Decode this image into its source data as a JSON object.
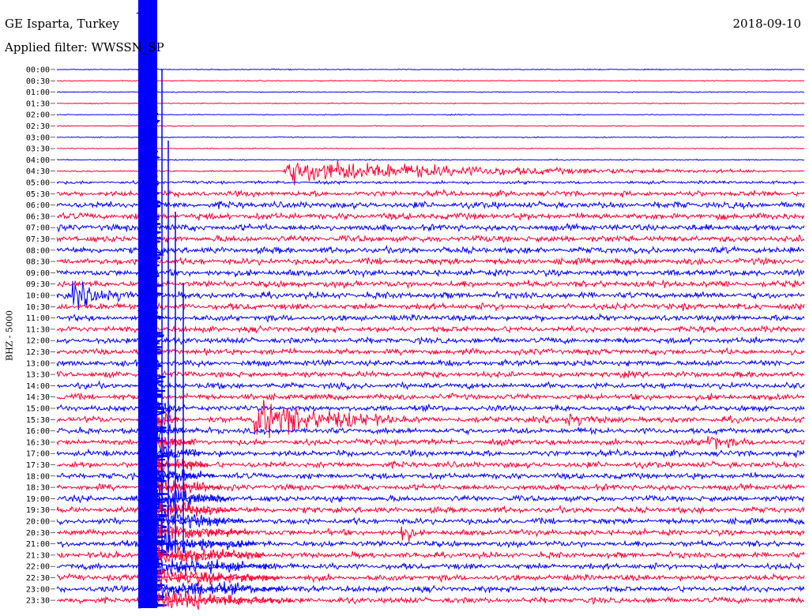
{
  "header": {
    "station": "GE Isparta, Turkey",
    "date": "2018-09-10",
    "filter": "Applied filter: WWSSN_SP"
  },
  "chart_data": {
    "type": "line",
    "title": "GE Isparta, Turkey",
    "date": "2018-09-10",
    "filter": "Applied filter: WWSSN_SP",
    "ylabel": "BHZ - 5000",
    "row_labels": [
      "00:00",
      "00:30",
      "01:00",
      "01:30",
      "02:00",
      "02:30",
      "03:00",
      "03:30",
      "04:00",
      "04:30",
      "05:00",
      "05:30",
      "06:00",
      "06:30",
      "07:00",
      "07:30",
      "08:00",
      "08:30",
      "09:00",
      "09:30",
      "10:00",
      "10:30",
      "11:00",
      "11:30",
      "12:00",
      "12:30",
      "13:00",
      "13:30",
      "14:00",
      "14:30",
      "15:00",
      "15:30",
      "16:00",
      "16:30",
      "17:00",
      "17:30",
      "18:00",
      "18:30",
      "19:00",
      "19:30",
      "20:00",
      "20:30",
      "21:00",
      "21:30",
      "22:00",
      "22:30",
      "23:00",
      "23:30"
    ],
    "series_colors": [
      "#0000ff",
      "#ff0033"
    ],
    "noise_levels": [
      0.4,
      0.4,
      0.4,
      0.4,
      0.4,
      0.4,
      0.4,
      0.4,
      0.45,
      0.6,
      1.2,
      2.2,
      2.6,
      2.6,
      2.6,
      2.6,
      2.6,
      2.6,
      2.6,
      2.6,
      2.6,
      2.6,
      2.4,
      2.4,
      2.4,
      2.4,
      2.4,
      2.4,
      2.4,
      2.4,
      2.4,
      2.4,
      2.4,
      2.4,
      2.4,
      2.4,
      2.4,
      2.4,
      2.4,
      2.4,
      2.4,
      2.4,
      2.4,
      2.4,
      2.4,
      2.4,
      2.4,
      2.4
    ],
    "events": [
      {
        "row": 9,
        "start": 0.3,
        "end": 0.95,
        "amp": 12,
        "decay": 0.35
      },
      {
        "row": 20,
        "start": 0.02,
        "end": 0.1,
        "amp": 12,
        "decay": 0.5
      },
      {
        "row": 31,
        "start": 0.26,
        "end": 0.45,
        "amp": 18,
        "decay": 0.5
      },
      {
        "row": 31,
        "start": 0.68,
        "end": 0.73,
        "amp": 7,
        "decay": 0.5
      },
      {
        "row": 33,
        "start": 0.87,
        "end": 0.92,
        "amp": 7,
        "decay": 0.5
      },
      {
        "row": 41,
        "start": 0.46,
        "end": 0.48,
        "amp": 12,
        "decay": 0.5
      }
    ]
  }
}
